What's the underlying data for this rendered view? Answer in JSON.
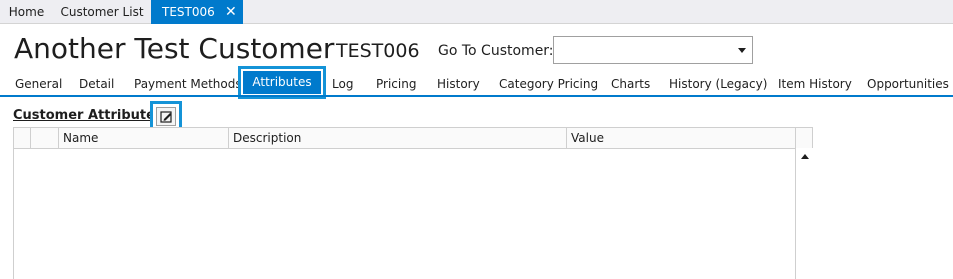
{
  "doc_tabs": [
    {
      "label": "Home"
    },
    {
      "label": "Customer List"
    },
    {
      "label": "TEST006",
      "active": true
    }
  ],
  "close_glyph": "✕",
  "header": {
    "customer_name": "Another Test Customer",
    "customer_code": "TEST006",
    "goto_label": "Go To Customer:",
    "goto_value": ""
  },
  "sub_tabs": [
    {
      "label": "General"
    },
    {
      "label": "Detail"
    },
    {
      "label": "Payment Methods"
    },
    {
      "label": "Attributes",
      "active": true
    },
    {
      "label": "Log"
    },
    {
      "label": "Pricing"
    },
    {
      "label": "History"
    },
    {
      "label": "Category Pricing"
    },
    {
      "label": "Charts"
    },
    {
      "label": "History (Legacy)"
    },
    {
      "label": "Item History"
    },
    {
      "label": "Opportunities"
    }
  ],
  "section": {
    "title": "Customer Attributes",
    "edit_icon": "edit-icon"
  },
  "grid": {
    "columns": [
      "Name",
      "Description",
      "Value"
    ],
    "rows": []
  },
  "colors": {
    "accent": "#007acc",
    "highlight": "#1493d7"
  }
}
